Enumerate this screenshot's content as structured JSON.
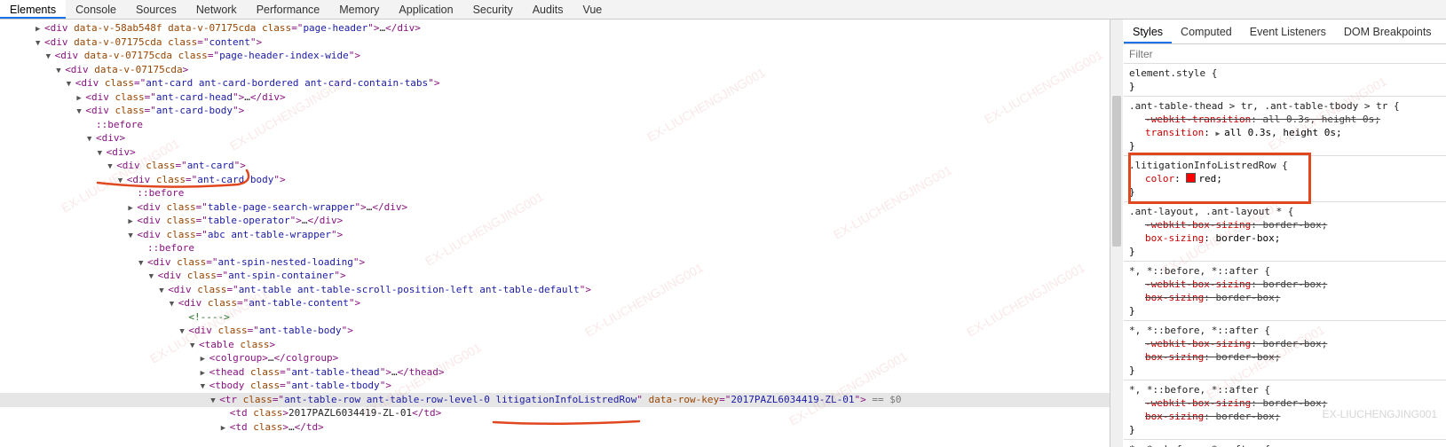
{
  "devtools": {
    "tabs": [
      "Elements",
      "Console",
      "Sources",
      "Network",
      "Performance",
      "Memory",
      "Application",
      "Security",
      "Audits",
      "Vue"
    ],
    "active_tab": 0
  },
  "dom_tree": [
    {
      "indent": 0,
      "toggle": "collapsed",
      "tag": "div",
      "attrs": [
        {
          "n": "data-v-58ab548f"
        },
        {
          "n": "data-v-07175cda"
        },
        {
          "n": "class",
          "v": "page-header"
        }
      ],
      "collapsed_text": "…",
      "close": "</div>"
    },
    {
      "indent": 0,
      "toggle": "expanded",
      "tag": "div",
      "attrs": [
        {
          "n": "data-v-07175cda"
        },
        {
          "n": "class",
          "v": "content"
        }
      ]
    },
    {
      "indent": 1,
      "toggle": "expanded",
      "tag": "div",
      "attrs": [
        {
          "n": "data-v-07175cda"
        },
        {
          "n": "class",
          "v": "page-header-index-wide"
        }
      ]
    },
    {
      "indent": 2,
      "toggle": "expanded",
      "tag": "div",
      "attrs": [
        {
          "n": "data-v-07175cda"
        }
      ]
    },
    {
      "indent": 3,
      "toggle": "expanded",
      "tag": "div",
      "attrs": [
        {
          "n": "class",
          "v": "ant-card ant-card-bordered ant-card-contain-tabs"
        }
      ]
    },
    {
      "indent": 4,
      "toggle": "collapsed",
      "tag": "div",
      "attrs": [
        {
          "n": "class",
          "v": "ant-card-head"
        }
      ],
      "collapsed_text": "…",
      "close": "</div>"
    },
    {
      "indent": 4,
      "toggle": "expanded",
      "tag": "div",
      "attrs": [
        {
          "n": "class",
          "v": "ant-card-body"
        }
      ]
    },
    {
      "indent": 5,
      "pseudo": "::before"
    },
    {
      "indent": 5,
      "toggle": "expanded",
      "tag": "div",
      "attrs": []
    },
    {
      "indent": 6,
      "toggle": "expanded",
      "tag": "div",
      "attrs": []
    },
    {
      "indent": 7,
      "toggle": "expanded",
      "tag": "div",
      "attrs": [
        {
          "n": "class",
          "v": "ant-card"
        }
      ]
    },
    {
      "indent": 8,
      "toggle": "expanded",
      "tag": "div",
      "attrs": [
        {
          "n": "class",
          "v": "ant-card-body"
        }
      ]
    },
    {
      "indent": 9,
      "pseudo": "::before"
    },
    {
      "indent": 9,
      "toggle": "collapsed",
      "tag": "div",
      "attrs": [
        {
          "n": "class",
          "v": "table-page-search-wrapper"
        }
      ],
      "collapsed_text": "…",
      "close": "</div>"
    },
    {
      "indent": 9,
      "toggle": "collapsed",
      "tag": "div",
      "attrs": [
        {
          "n": "class",
          "v": "table-operator"
        }
      ],
      "collapsed_text": "…",
      "close": "</div>"
    },
    {
      "indent": 9,
      "toggle": "expanded",
      "tag": "div",
      "attrs": [
        {
          "n": "class",
          "v": "abc ant-table-wrapper"
        }
      ]
    },
    {
      "indent": 10,
      "pseudo": "::before"
    },
    {
      "indent": 10,
      "toggle": "expanded",
      "tag": "div",
      "attrs": [
        {
          "n": "class",
          "v": "ant-spin-nested-loading"
        }
      ]
    },
    {
      "indent": 11,
      "toggle": "expanded",
      "tag": "div",
      "attrs": [
        {
          "n": "class",
          "v": "ant-spin-container"
        }
      ]
    },
    {
      "indent": 12,
      "toggle": "expanded",
      "tag": "div",
      "attrs": [
        {
          "n": "class",
          "v": "ant-table ant-table-scroll-position-left ant-table-default"
        }
      ]
    },
    {
      "indent": 13,
      "toggle": "expanded",
      "tag": "div",
      "attrs": [
        {
          "n": "class",
          "v": "ant-table-content"
        }
      ]
    },
    {
      "indent": 14,
      "comment": "<!---->"
    },
    {
      "indent": 14,
      "toggle": "expanded",
      "tag": "div",
      "attrs": [
        {
          "n": "class",
          "v": "ant-table-body"
        }
      ]
    },
    {
      "indent": 15,
      "toggle": "expanded",
      "tag": "table",
      "attrs": [
        {
          "n": "class"
        }
      ]
    },
    {
      "indent": 16,
      "toggle": "collapsed",
      "tag": "colgroup",
      "attrs": [],
      "collapsed_text": "…",
      "close": "</colgroup>"
    },
    {
      "indent": 16,
      "toggle": "collapsed",
      "tag": "thead",
      "attrs": [
        {
          "n": "class",
          "v": "ant-table-thead"
        }
      ],
      "collapsed_text": "…",
      "close": "</thead>"
    },
    {
      "indent": 16,
      "toggle": "expanded",
      "tag": "tbody",
      "attrs": [
        {
          "n": "class",
          "v": "ant-table-tbody"
        }
      ]
    },
    {
      "indent": 17,
      "toggle": "expanded",
      "tag": "tr",
      "attrs": [
        {
          "n": "class",
          "v": "ant-table-row ant-table-row-level-0 litigationInfoListredRow"
        },
        {
          "n": "data-row-key",
          "v": "2017PAZL6034419-ZL-01"
        }
      ],
      "selected": true,
      "suffix": "== $0"
    },
    {
      "indent": 18,
      "tag": "td",
      "attrs": [
        {
          "n": "class"
        }
      ],
      "text": "2017PAZL6034419-ZL-01",
      "close": "</td>"
    },
    {
      "indent": 18,
      "toggle": "collapsed",
      "tag": "td",
      "attrs": [
        {
          "n": "class"
        }
      ],
      "collapsed_text": "…",
      "close": "</td>"
    }
  ],
  "styles_panel": {
    "tabs": [
      "Styles",
      "Computed",
      "Event Listeners",
      "DOM Breakpoints",
      "Properties"
    ],
    "active_tab": 0,
    "filter_placeholder": "Filter",
    "rules": [
      {
        "selector": "element.style {",
        "decls": []
      },
      {
        "selector": ".ant-table-thead > tr, .ant-table-tbody > tr {",
        "decls": [
          {
            "name": "-webkit-transition",
            "value": "all 0.3s, height 0s",
            "struck": true
          },
          {
            "name": "transition",
            "value": "all 0.3s, height 0s",
            "expand": true
          }
        ]
      },
      {
        "selector": ".litigationInfoListredRow {",
        "highlighted": true,
        "decls": [
          {
            "name": "color",
            "value": "red",
            "swatch": "#ff0000"
          }
        ]
      },
      {
        "selector": ".ant-layout, .ant-layout * {",
        "decls": [
          {
            "name": "-webkit-box-sizing",
            "value": "border-box",
            "struck": true
          },
          {
            "name": "box-sizing",
            "value": "border-box"
          }
        ]
      },
      {
        "selector": "*, *::before, *::after {",
        "decls": [
          {
            "name": "-webkit-box-sizing",
            "value": "border-box",
            "struck": true
          },
          {
            "name": "box-sizing",
            "value": "border-box",
            "struck": true
          }
        ]
      },
      {
        "selector": "*, *::before, *::after {",
        "decls": [
          {
            "name": "-webkit-box-sizing",
            "value": "border-box",
            "struck": true
          },
          {
            "name": "box-sizing",
            "value": "border-box",
            "struck": true
          }
        ]
      },
      {
        "selector": "*, *::before, *::after {",
        "decls": [
          {
            "name": "-webkit-box-sizing",
            "value": "border-box",
            "struck": true
          },
          {
            "name": "box-sizing",
            "value": "border-box",
            "struck": true
          }
        ]
      },
      {
        "selector": "*, *::before, *::after {",
        "decls": []
      }
    ]
  },
  "watermark_text": "EX-LIUCHENGJING001",
  "colors": {
    "accent": "#1a73e8",
    "annotation": "#e0471f"
  }
}
